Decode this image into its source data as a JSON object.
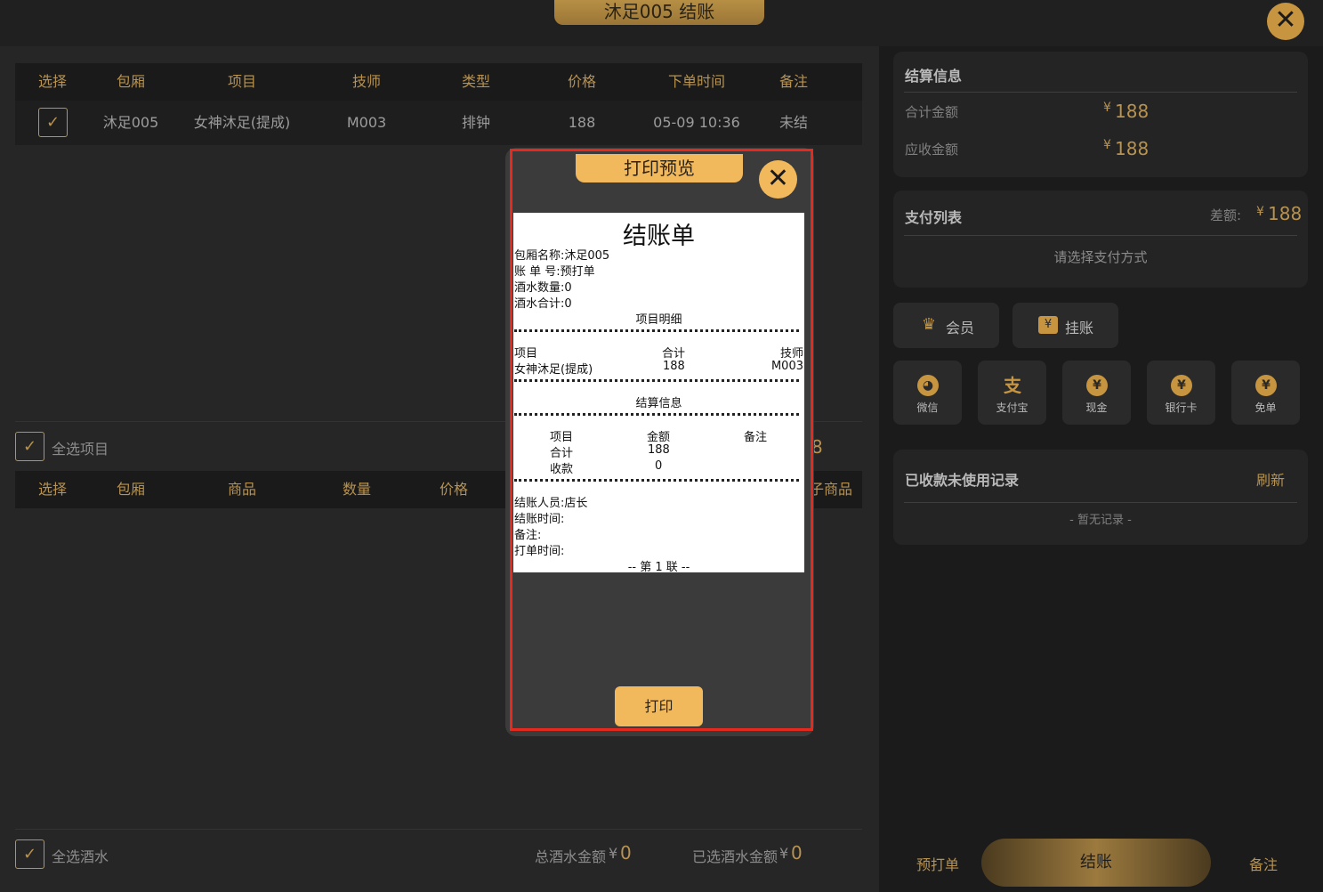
{
  "window": {
    "title": "沐足005 结账"
  },
  "items_table": {
    "headers": [
      "选择",
      "包厢",
      "项目",
      "技师",
      "类型",
      "价格",
      "下单时间",
      "备注"
    ],
    "rows": [
      {
        "room": "沐足005",
        "item": "女神沐足(提成)",
        "tech": "M003",
        "type": "排钟",
        "price": "188",
        "time": "05-09 10:36",
        "note": "未结"
      }
    ]
  },
  "select_all_items": "全选项目",
  "drinks_table": {
    "headers": [
      "选择",
      "包厢",
      "商品",
      "数量",
      "价格"
    ],
    "hidden_header_fragment": "子商品",
    "hidden_total_fragment": "8"
  },
  "select_all_drinks": "全选酒水",
  "drinks_total": {
    "label": "总酒水金额",
    "currency": "¥",
    "value": "0"
  },
  "drinks_selected": {
    "label": "已选酒水金额",
    "currency": "¥",
    "value": "0"
  },
  "settlement": {
    "title": "结算信息",
    "total_label": "合计金额",
    "total_value": "188",
    "receivable_label": "应收金额",
    "receivable_value": "188",
    "currency": "¥"
  },
  "payments": {
    "title": "支付列表",
    "diff_label": "差额:",
    "diff_value": "188",
    "currency": "¥",
    "placeholder": "请选择支付方式"
  },
  "actions": {
    "member": "会员",
    "credit": "挂账"
  },
  "pay_methods": [
    "微信",
    "支付宝",
    "现金",
    "银行卡",
    "免单"
  ],
  "unused_records": {
    "title": "已收款未使用记录",
    "refresh": "刷新",
    "empty": "- 暂无记录 -"
  },
  "footer": {
    "preprint": "预打单",
    "checkout": "结账",
    "remark": "备注"
  },
  "print_preview": {
    "title": "打印预览",
    "print_button": "打印",
    "receipt": {
      "heading": "结账单",
      "room_line": "包厢名称:沐足005",
      "bill_no_line": "账 单 号:预打单",
      "drink_count_line": "酒水数量:0",
      "drink_total_line": "酒水合计:0",
      "detail_title": "项目明细",
      "detail_headers": [
        "项目",
        "合计",
        "技师"
      ],
      "detail_row": [
        "女神沐足(提成)",
        "188",
        "M003"
      ],
      "settle_title": "结算信息",
      "settle_headers": [
        "项目",
        "金额",
        "备注"
      ],
      "settle_rows": [
        [
          "合计",
          "188"
        ],
        [
          "收款",
          "0"
        ]
      ],
      "cashier_line": "结账人员:店长",
      "checkout_time_line": "结账时间:",
      "remark_line": "备注:",
      "print_time_line": "打单时间:",
      "copy_line": "-- 第 1 联 --"
    }
  },
  "colors": {
    "accent": "#b8924f",
    "gold_button": "#f2b85c",
    "highlight_frame": "#e4291f"
  }
}
